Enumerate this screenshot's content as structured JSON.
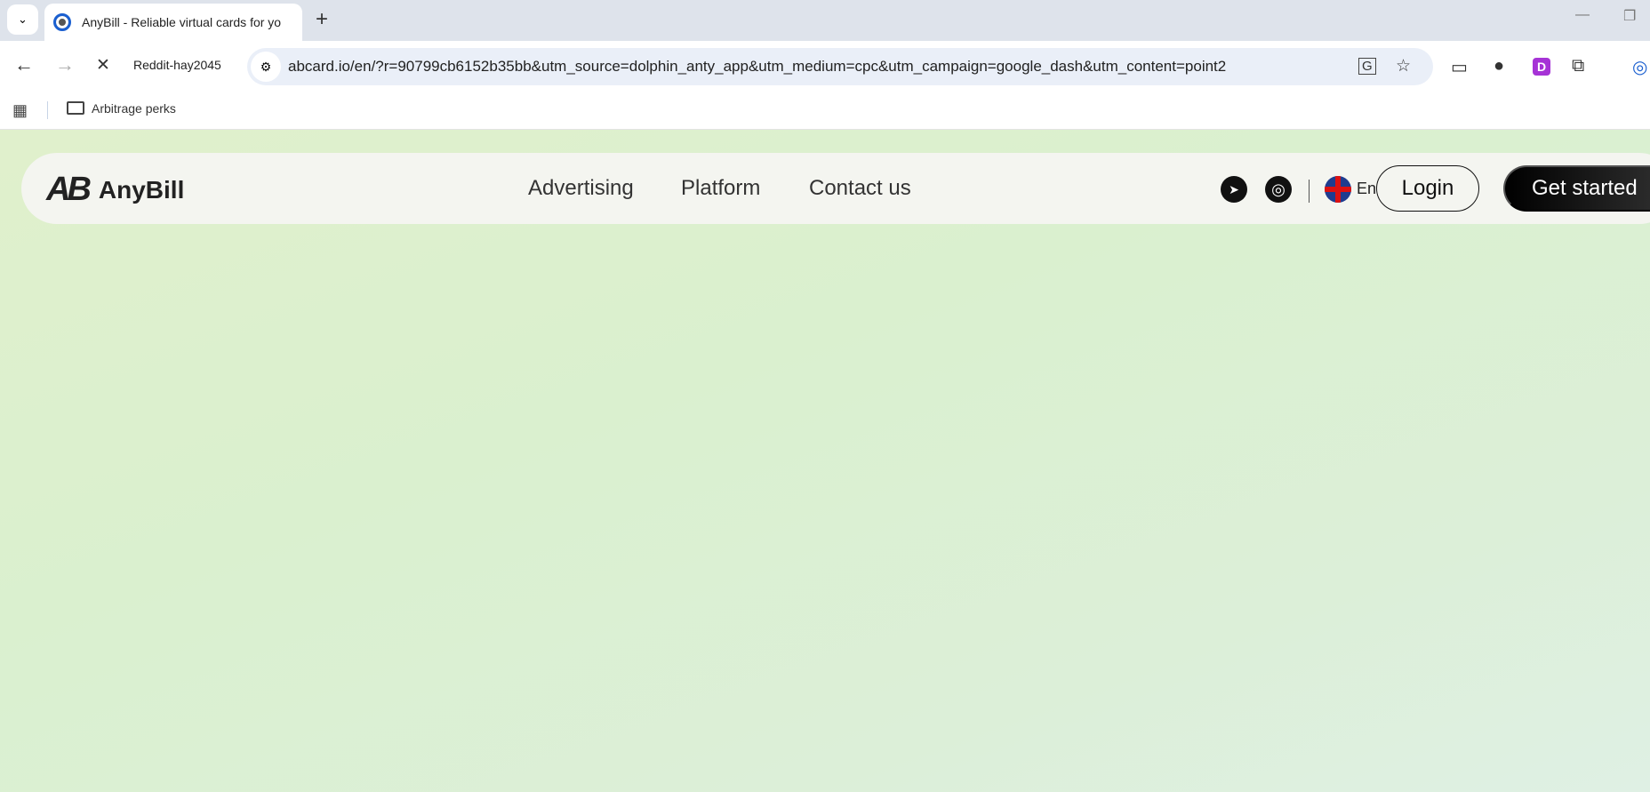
{
  "browser": {
    "tab_title": "AnyBill - Reliable virtual cards for yo",
    "new_tab": "+",
    "profile_label": "Reddit-hay2045",
    "url": "abcard.io/en/?r=90799cb6152b35bb&utm_source=dolphin_anty_app&utm_medium=cpc&utm_campaign=google_dash&utm_content=point2",
    "bookmark": "Arbitrage perks",
    "icons": {
      "back": "←",
      "forward": "→",
      "stop": "✕",
      "tune": "⚙",
      "translate": "G",
      "star": "☆",
      "video": "▭",
      "cookie": "●",
      "ext_d": "D",
      "puzzle": "⧉",
      "profile": "◎",
      "tab_dropdown": "⌄",
      "minimize": "—",
      "restore": "❐",
      "apps": "▦"
    }
  },
  "site": {
    "brand": "AnyBill",
    "logo_mark": "AB",
    "nav": [
      "Advertising",
      "Platform",
      "Contact us"
    ],
    "lang": "En",
    "login": "Login",
    "get_started": "Get started",
    "icons": {
      "telegram": "➤",
      "instagram": "◎"
    }
  }
}
